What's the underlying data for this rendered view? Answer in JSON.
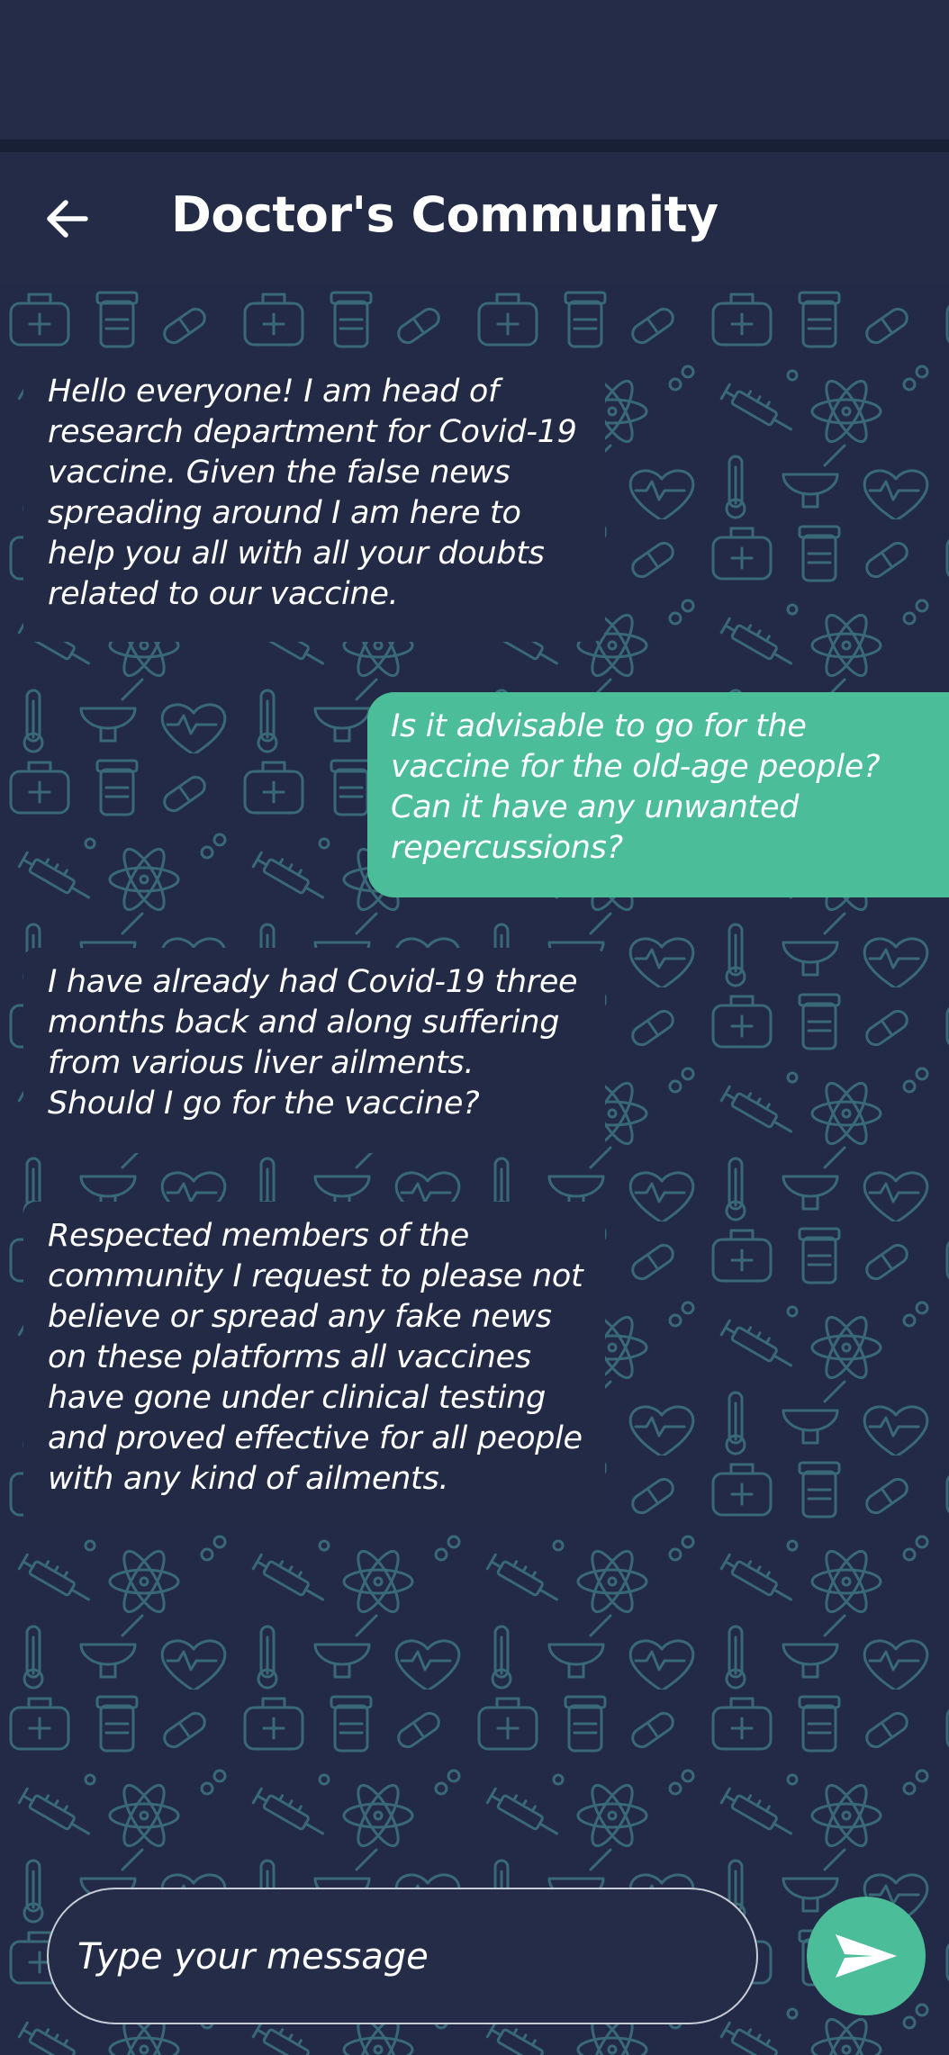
{
  "app_bar": {
    "title": "Doctor's Community",
    "back_icon": "arrow-left-icon"
  },
  "messages": [
    {
      "direction": "received",
      "text": "Hello everyone! I am head of\nresearch department for Covid-19\nvaccine. Given the false news\nspreading around I am here to\nhelp you all with all your doubts\nrelated to our vaccine."
    },
    {
      "direction": "sent",
      "text": "Is it advisable to go for the\nvaccine for the old-age people?\nCan it have any unwanted\nrepercussions?"
    },
    {
      "direction": "received",
      "text": "I have already had Covid-19 three\nmonths back and along suffering\nfrom various liver ailments.\nShould I go for the vaccine?"
    },
    {
      "direction": "received",
      "text": "Respected members of the\ncommunity I request to please not\nbelieve or spread any fake news\non these platforms all vaccines\nhave gone under clinical testing\nand proved effective for all people\nwith any kind of ailments."
    }
  ],
  "composer": {
    "placeholder": "Type your message",
    "value": "",
    "send_icon": "send-icon"
  },
  "colors": {
    "background": "#222a47",
    "app_bar": "#242b47",
    "sent_bubble": "#4bbd98",
    "received_bubble": "#232a46",
    "accent": "#4bbd98",
    "wallpaper_doodle": "#3f7d86"
  }
}
